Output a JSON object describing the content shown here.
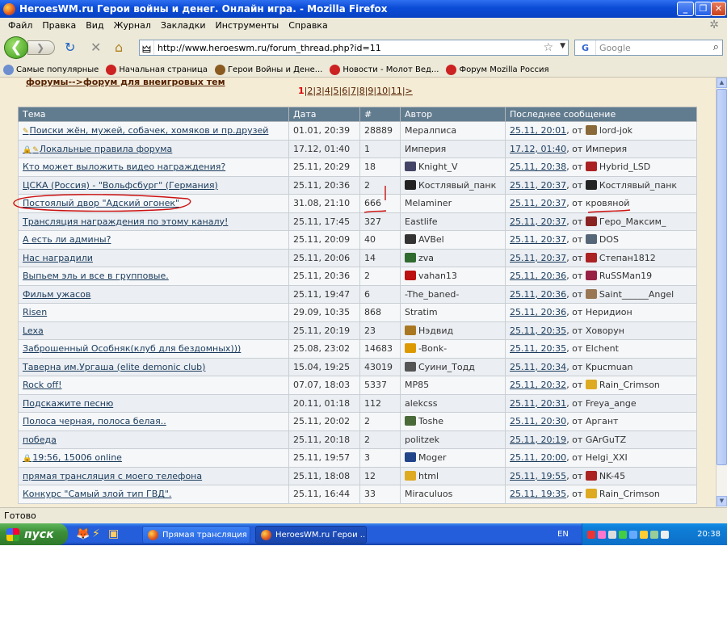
{
  "window": {
    "title": "HeroesWM.ru Герои войны и денег. Онлайн игра. - Mozilla Firefox",
    "min_glyph": "_",
    "max_glyph": "❐",
    "close_glyph": "✕"
  },
  "menu": [
    "Файл",
    "Правка",
    "Вид",
    "Журнал",
    "Закладки",
    "Инструменты",
    "Справка"
  ],
  "nav": {
    "back_glyph": "❮",
    "forward_glyph": "❯",
    "reload_glyph": "↻",
    "stop_glyph": "✕",
    "home_glyph": "⌂",
    "url": "http://www.heroeswm.ru/forum_thread.php?id=11",
    "search_placeholder": "Google",
    "search_engine_letter": "G"
  },
  "bookmarks": [
    {
      "label": "Самые популярные",
      "icon": "popular-icon",
      "color": "#6d8fd0"
    },
    {
      "label": "Начальная страница",
      "icon": "firefox-bookmark-icon",
      "color": "#cc2222"
    },
    {
      "label": "Герои Войны и Дене...",
      "icon": "heroes-bookmark-icon",
      "color": "#8a5a20"
    },
    {
      "label": "Новости - Молот Вед...",
      "icon": "news-bookmark-icon",
      "color": "#cc2222"
    },
    {
      "label": "Форум Mozilla Россия",
      "icon": "mozilla-forum-bookmark-icon",
      "color": "#cc2222"
    }
  ],
  "breadcrumb": {
    "forums": "форумы",
    "sep": "-->",
    "section": "форум для внеигровых тем"
  },
  "pagination": {
    "current": "1",
    "pages": [
      "2",
      "3",
      "4",
      "5",
      "6",
      "7",
      "8",
      "9",
      "10",
      "11"
    ],
    "next": ">"
  },
  "table": {
    "headers": [
      "Тема",
      "Дата",
      "#",
      "Автор",
      "Последнее сообщение"
    ],
    "rows": [
      {
        "marker": "pin",
        "topic": "Поиски жён, мужей, собачек, хомяков и пр.друзей",
        "date": "01.01, 20:39",
        "count": "28889",
        "author": "Мералписа",
        "author_icon": false,
        "last_date": "25.11, 20:01",
        "last_by": ", от ",
        "last_author": "lord-jok",
        "last_icon": true,
        "last_color": "#8a6a3a"
      },
      {
        "marker": "lockpin",
        "topic": "Локальные правила форума",
        "date": "17.12, 01:40",
        "count": "1",
        "author": "Империя",
        "author_icon": false,
        "last_date": "17.12, 01:40",
        "last_by": ", от ",
        "last_author": "Империя",
        "last_icon": false,
        "last_color": ""
      },
      {
        "marker": "",
        "topic": "Кто может выложить видео награждения?",
        "date": "25.11, 20:29",
        "count": "18",
        "author": "Knight_V",
        "author_icon": true,
        "author_color": "#444466",
        "last_date": "25.11, 20:38",
        "last_by": ", от ",
        "last_author": "Hybrid_LSD",
        "last_icon": true,
        "last_color": "#aa2222"
      },
      {
        "marker": "",
        "topic": "ЦСКА (Россия) - \"Вольфсбург\" (Германия)",
        "date": "25.11, 20:36",
        "count": "2",
        "author": "Костлявый_панк",
        "author_icon": true,
        "author_color": "#222222",
        "last_date": "25.11, 20:37",
        "last_by": ", от ",
        "last_author": "Костлявый_панк",
        "last_icon": true,
        "last_color": "#222222"
      },
      {
        "marker": "",
        "topic": "Постоялый двор \"Адский огонек\"",
        "date": "31.08, 21:10",
        "count": "666",
        "author": "Melaminer",
        "author_icon": false,
        "last_date": "25.11, 20:37",
        "last_by": ", от ",
        "last_author": "кровяной",
        "last_icon": false,
        "last_color": ""
      },
      {
        "marker": "",
        "topic": "Трансляция награждения по этому каналу!",
        "date": "25.11, 17:45",
        "count": "327",
        "author": "Eastlife",
        "author_icon": false,
        "last_date": "25.11, 20:37",
        "last_by": ", от ",
        "last_author": "Геро_Максим_",
        "last_icon": true,
        "last_color": "#8a2222"
      },
      {
        "marker": "",
        "topic": "А есть ли админы?",
        "date": "25.11, 20:09",
        "count": "40",
        "author": "AVBel",
        "author_icon": true,
        "author_color": "#333333",
        "last_date": "25.11, 20:37",
        "last_by": ", от ",
        "last_author": "DOS",
        "last_icon": true,
        "last_color": "#556677"
      },
      {
        "marker": "",
        "topic": "Нас наградили",
        "date": "25.11, 20:06",
        "count": "14",
        "author": "zva",
        "author_icon": true,
        "author_color": "#2f6a2f",
        "last_date": "25.11, 20:37",
        "last_by": ", от ",
        "last_author": "Степан1812",
        "last_icon": true,
        "last_color": "#aa2222"
      },
      {
        "marker": "",
        "topic": "Выпьем эль и все в групповые.",
        "date": "25.11, 20:36",
        "count": "2",
        "author": "vahan13",
        "author_icon": true,
        "author_color": "#bb1111",
        "last_date": "25.11, 20:36",
        "last_by": ", от ",
        "last_author": "RuSSMan19",
        "last_icon": true,
        "last_color": "#992244"
      },
      {
        "marker": "",
        "topic": "Фильм ужасов",
        "date": "25.11, 19:47",
        "count": "6",
        "author": "-The_baned-",
        "author_icon": false,
        "last_date": "25.11, 20:36",
        "last_by": ", от ",
        "last_author": "Saint______Angel",
        "last_icon": true,
        "last_color": "#997755"
      },
      {
        "marker": "",
        "topic": "Risen",
        "date": "29.09, 10:35",
        "count": "868",
        "author": "Stratim",
        "author_icon": false,
        "last_date": "25.11, 20:36",
        "last_by": ", от ",
        "last_author": "Неридион",
        "last_icon": false,
        "last_color": ""
      },
      {
        "marker": "",
        "topic": "Lexa",
        "date": "25.11, 20:19",
        "count": "23",
        "author": "Нэдвид",
        "author_icon": true,
        "author_color": "#aa7722",
        "last_date": "25.11, 20:35",
        "last_by": ", от ",
        "last_author": "Ховорун",
        "last_icon": false,
        "last_color": ""
      },
      {
        "marker": "",
        "topic": "Заброшенный Особняк(клуб для бездомных)))",
        "date": "25.08, 23:02",
        "count": "14683",
        "author": "-Bonk-",
        "author_icon": true,
        "author_color": "#dd9900",
        "last_date": "25.11, 20:35",
        "last_by": ", от ",
        "last_author": "Elchent",
        "last_icon": false,
        "last_color": ""
      },
      {
        "marker": "",
        "topic": "Таверна им.Ургаша (elite demonic club)",
        "date": "15.04, 19:25",
        "count": "43019",
        "author": "Суини_Тодд",
        "author_icon": true,
        "author_color": "#555555",
        "last_date": "25.11, 20:34",
        "last_by": ", от ",
        "last_author": "Kpucmuan",
        "last_icon": false,
        "last_color": ""
      },
      {
        "marker": "",
        "topic": "Rock off!",
        "date": "07.07, 18:03",
        "count": "5337",
        "author": "MP85",
        "author_icon": false,
        "last_date": "25.11, 20:32",
        "last_by": ", от ",
        "last_author": "Rain_Crimson",
        "last_icon": true,
        "last_color": "#ddaa22"
      },
      {
        "marker": "",
        "topic": "Подскажите песню",
        "date": "20.11, 01:18",
        "count": "112",
        "author": "alekcss",
        "author_icon": false,
        "last_date": "25.11, 20:31",
        "last_by": ", от ",
        "last_author": "Freya_ange",
        "last_icon": false,
        "last_color": ""
      },
      {
        "marker": "",
        "topic": "Полоса черная, полоса белая..",
        "date": "25.11, 20:02",
        "count": "2",
        "author": "Toshe",
        "author_icon": true,
        "author_color": "#4a6a3a",
        "last_date": "25.11, 20:30",
        "last_by": ", от ",
        "last_author": "Аргант",
        "last_icon": false,
        "last_color": ""
      },
      {
        "marker": "",
        "topic": "победа",
        "date": "25.11, 20:18",
        "count": "2",
        "author": "politzek",
        "author_icon": false,
        "last_date": "25.11, 20:19",
        "last_by": ", от ",
        "last_author": "GArGuTZ",
        "last_icon": false,
        "last_color": ""
      },
      {
        "marker": "lock",
        "topic": "19:56, 15006 online",
        "date": "25.11, 19:57",
        "count": "3",
        "author": "Moger",
        "author_icon": true,
        "author_color": "#224488",
        "last_date": "25.11, 20:00",
        "last_by": ", от ",
        "last_author": "Helgi_XXI",
        "last_icon": false,
        "last_color": ""
      },
      {
        "marker": "",
        "topic": "прямая трансляция с моего телефона",
        "date": "25.11, 18:08",
        "count": "12",
        "author": "html",
        "author_icon": true,
        "author_color": "#ddaa22",
        "last_date": "25.11, 19:55",
        "last_by": ", от ",
        "last_author": "NK-45",
        "last_icon": true,
        "last_color": "#aa2222"
      },
      {
        "marker": "",
        "topic": "Конкурс \"Самый злой тип ГВД\".",
        "date": "25.11, 16:44",
        "count": "33",
        "author": "Miraculuos",
        "author_icon": false,
        "last_date": "25.11, 19:35",
        "last_by": ", от ",
        "last_author": "Rain_Crimson",
        "last_icon": true,
        "last_color": "#ddaa22"
      }
    ]
  },
  "status": "Готово",
  "taskbar": {
    "start": "пуск",
    "tasks": [
      "Прямая трансляция ...",
      "HeroesWM.ru Герои ..."
    ],
    "lang": "EN",
    "clock": "20:38"
  }
}
